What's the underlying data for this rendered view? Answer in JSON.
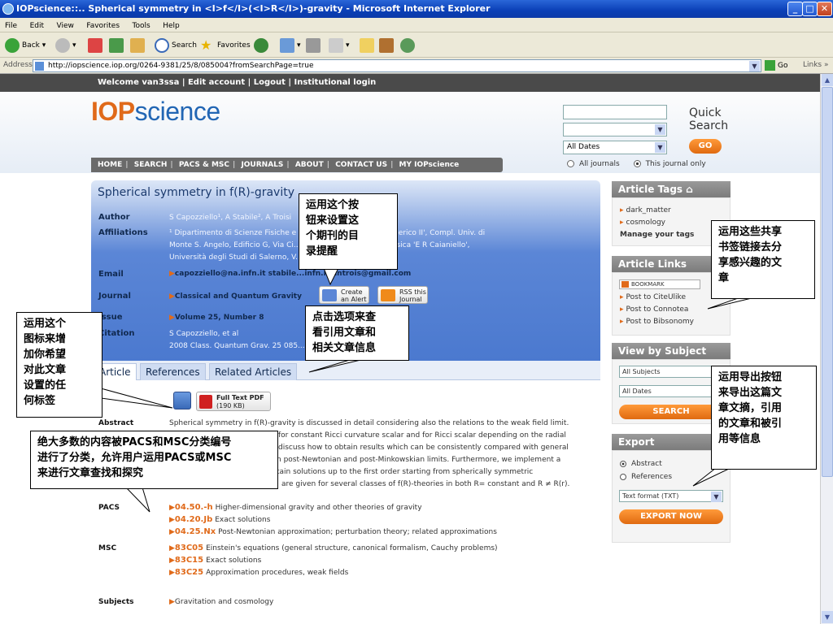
{
  "window": {
    "title": "IOPscience::.. Spherical symmetry in <I>f</I>(<I>R</I>)-gravity - Microsoft Internet Explorer",
    "btn_min": "_",
    "btn_max": "□",
    "btn_close": "✕"
  },
  "menu": [
    "File",
    "Edit",
    "View",
    "Favorites",
    "Tools",
    "Help"
  ],
  "toolbar": {
    "back": "Back",
    "search": "Search",
    "favorites": "Favorites"
  },
  "address": {
    "label": "Address",
    "url": "http://iopscience.iop.org/0264-9381/25/8/085004?fromSearchPage=true",
    "go": "Go",
    "links": "Links"
  },
  "site": {
    "topbar": "Welcome van3ssa | Edit account | Logout | Institutional login",
    "logo_prefix": "IOP",
    "logo_suffix": "science",
    "nav": [
      "HOME",
      "SEARCH",
      "PACS & MSC",
      "JOURNALS",
      "ABOUT",
      "CONTACT US",
      "MY IOPscience"
    ],
    "nav_sep": "|",
    "quick_search": {
      "title_1": "Quick",
      "title_2": "Search",
      "date_select": "All Dates",
      "go": "GO",
      "radio_all": "All journals",
      "radio_this": "This journal only"
    }
  },
  "article": {
    "title": "Spherical symmetry in f(R)-gravity",
    "labels": {
      "author": "Author",
      "affiliations": "Affiliations",
      "email": "Email",
      "journal": "Journal",
      "issue": "Issue",
      "citation": "Citation"
    },
    "author": "S Capozziello¹, A Stabile², A Troisi",
    "affil_1": "¹ Dipartimento di Scienze Fisiche e ...                                    ...niversità di Napoli 'Federico II', Compl. Univ. di",
    "affil_2": "Monte S. Angelo, Edificio G, Via Ci...                              ...taly ² Dipartimento di Fisica 'E R Caianiello',",
    "affil_3": "Università degli Studi di Salerno, V...                              ...nissi (SA), Italy",
    "email": "capozziello@na.infn.it    stabile...infn.it    antrois@gmail.com",
    "journal": "Classical and Quantum Gravity",
    "issue": "Volume 25, Number 8",
    "citation_1": "S Capozziello,  et al",
    "citation_2": "2008 Class. Quantum Grav. 25 085...                    ...64-9381/25/8/085004",
    "create_alert": "Create\nan Alert",
    "rss": "RSS this\nJournal"
  },
  "tabs": [
    "Article",
    "References",
    "Related Articles"
  ],
  "fulltext": {
    "label": "Full Text PDF",
    "size": "(190 KB)"
  },
  "body": {
    "abstract_label": "Abstract",
    "abstract_lines": [
      "Spherical symmetry in f(R)-gravity is discussed in detail considering also the relations to the weak field limit.",
      "for constant Ricci curvature scalar and for Ricci scalar depending on the radial",
      "discuss how to obtain results which can be consistently compared with general",
      "n post-Newtonian and post-Minkowskian limits. Furthermore, we implement a",
      "tain solutions up to the first order starting from spherically symmetric",
      "are given for several classes of f(R)-theories in both R= constant and R ≠ R(r)."
    ],
    "pacs_label": "PACS",
    "pacs": [
      {
        "code": "04.50.-h",
        "desc": "Higher-dimensional gravity and other theories of gravity"
      },
      {
        "code": "04.20.Jb",
        "desc": "Exact solutions"
      },
      {
        "code": "04.25.Nx",
        "desc": "Post-Newtonian approximation; perturbation theory; related approximations"
      }
    ],
    "msc_label": "MSC",
    "msc": [
      {
        "code": "83C05",
        "desc": "Einstein's equations (general structure, canonical formalism, Cauchy problems)"
      },
      {
        "code": "83C15",
        "desc": "Exact solutions"
      },
      {
        "code": "83C25",
        "desc": "Approximation procedures, weak fields"
      }
    ],
    "subjects_label": "Subjects",
    "subjects": "Gravitation and cosmology"
  },
  "sidebar": {
    "tags_head": "Article Tags",
    "tags": [
      "dark_matter",
      "cosmology"
    ],
    "manage_tags": "Manage your tags",
    "links_head": "Article Links",
    "bookmark": "BOOKMARK",
    "links": [
      "Post to CiteUlike",
      "Post to Connotea",
      "Post to Bibsonomy"
    ],
    "subject_head": "View by Subject",
    "subject_sel": "All Subjects",
    "date_sel": "All Dates",
    "search_btn": "SEARCH",
    "export_head": "Export",
    "export_abstract": "Abstract",
    "export_refs": "References",
    "format_sel": "Text format (TXT)",
    "export_btn": "EXPORT NOW"
  },
  "callouts": {
    "alert": "运用这个按\n钮来设置这\n个期刊的目\n录提醒",
    "tabs": "点击选项来查\n看引用文章和\n相关文章信息",
    "tag": "运用这个\n图标来增\n加你希望\n对此文章\n设置的任\n何标签",
    "pacs": "绝大多数的内容被PACS和MSC分类编号\n进行了分类，允许用户运用PACS或MSC\n来进行文章查找和探究",
    "bookmark": "运用这些共享\n书签链接去分\n享感兴趣的文\n章",
    "export": "运用导出按钮\n来导出这篇文\n章文摘，引用\n的文章和被引\n用等信息"
  }
}
